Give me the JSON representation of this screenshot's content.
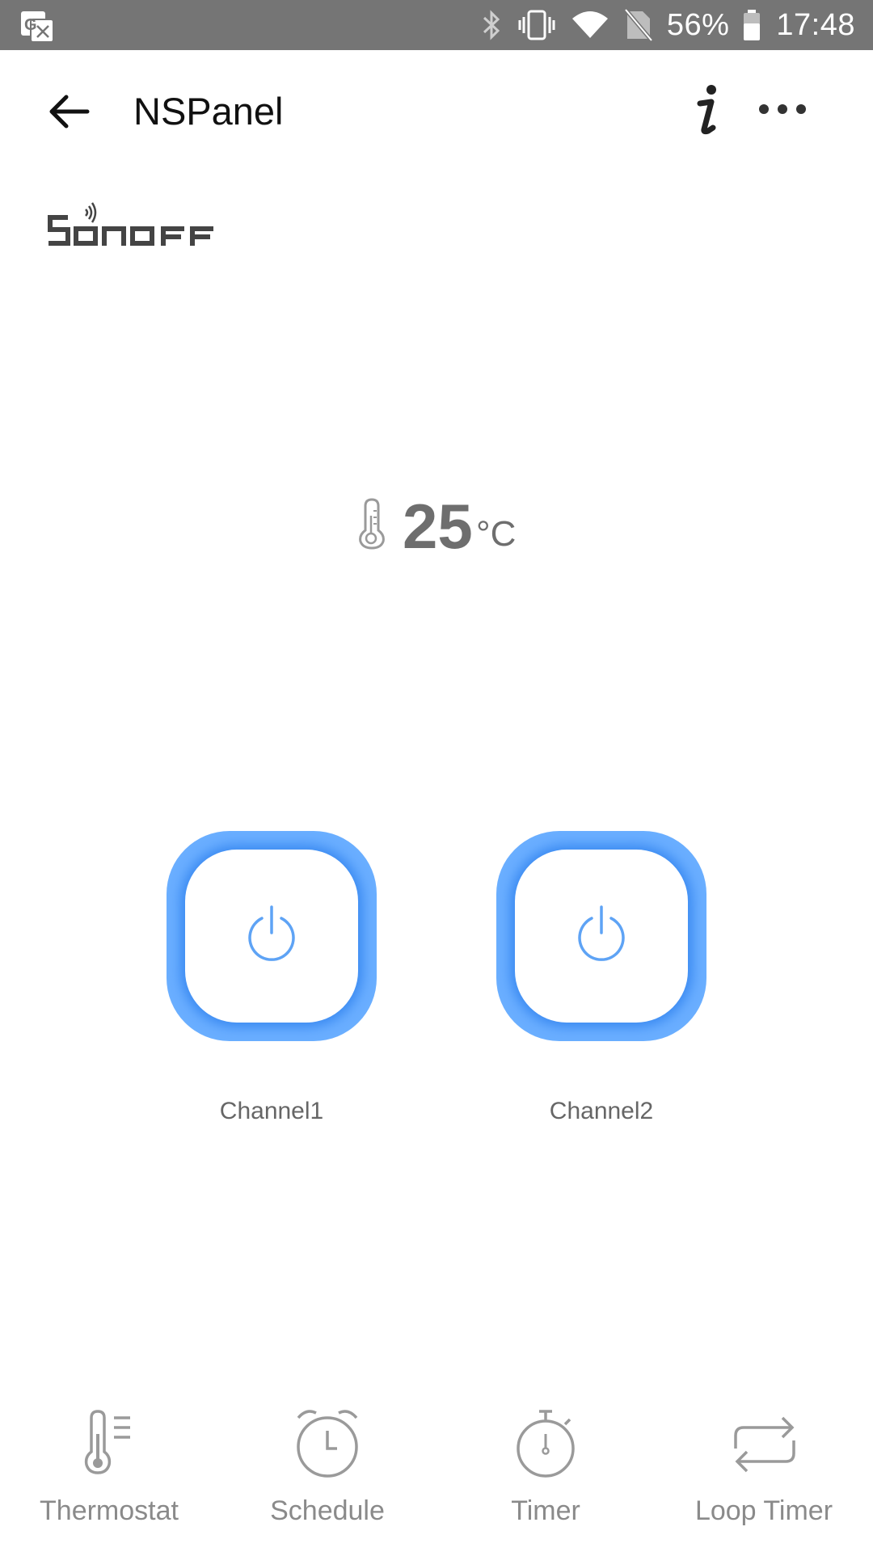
{
  "status_bar": {
    "battery_percent": "56%",
    "time": "17:48",
    "icons": [
      "translate-icon",
      "bluetooth-icon",
      "vibrate-icon",
      "wifi-icon",
      "no-sim-icon",
      "battery-icon"
    ]
  },
  "header": {
    "title": "NSPanel",
    "back_icon": "arrow-left-icon",
    "info_icon": "info-icon",
    "more_icon": "more-horizontal-icon"
  },
  "brand": {
    "logo_text": "SONOFF"
  },
  "temperature": {
    "value": "25",
    "unit": "°C",
    "icon": "thermometer-icon"
  },
  "channels": [
    {
      "label": "Channel1",
      "icon": "power-icon",
      "accent": "#6aaeff"
    },
    {
      "label": "Channel2",
      "icon": "power-icon",
      "accent": "#6aaeff"
    }
  ],
  "bottom_nav": [
    {
      "label": "Thermostat",
      "icon": "thermostat-icon"
    },
    {
      "label": "Schedule",
      "icon": "alarm-clock-icon"
    },
    {
      "label": "Timer",
      "icon": "stopwatch-icon"
    },
    {
      "label": "Loop Timer",
      "icon": "repeat-icon"
    }
  ],
  "colors": {
    "status_bar_bg": "#757575",
    "channel_accent": "#6aaeff",
    "power_icon": "#5ea3f5",
    "label_text": "#666666",
    "nav_text": "#8a8a8a"
  }
}
